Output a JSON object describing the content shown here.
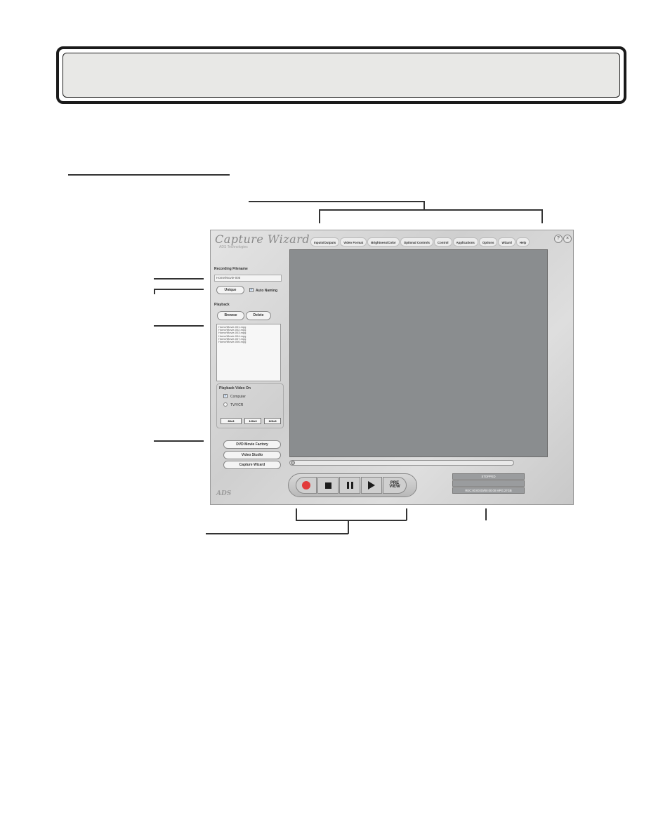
{
  "app": {
    "title": "Capture Wizard",
    "subtitle": "ADS Technologies",
    "help_btn": "?",
    "close_btn": "×",
    "tabs": [
      "Inputs/Outputs",
      "Video Format",
      "Brightness/Color",
      "Optional Controls",
      "Control",
      "Applications",
      "Options",
      "Wizard",
      "Help"
    ],
    "recording_label": "Recording Filename",
    "filename_value": "Home/Movie-005",
    "unique_btn": "Unique",
    "auto_naming_label": "Auto Naming",
    "playback_label": "Playback",
    "browse_btn": "Browse",
    "delete_btn": "Delete",
    "playback_files": [
      "Home/Movie-001.mpg",
      "Home/Movie-002.mpg",
      "Home/Movie-003.mpg",
      "Home/Movie-004.mpg",
      "Home/Movie-007.mpg",
      "Home/Movie-006.mpg"
    ],
    "playback_on_label": "Playback Video On",
    "option_computer": "Computer",
    "option_tvvcr": "TV/VCR",
    "rate_1": "80x3",
    "rate_2": "120x3",
    "rate_3": "120x3",
    "app_btn_1": "DVD Movie Factory",
    "app_btn_2": "Video Studio",
    "app_btn_3": "Capture Wizard",
    "preview_label_top": "PRE",
    "preview_label_bottom": "VIEW",
    "status_top": "STOPPED",
    "status_bottom": "REC:00:00:00/00:00:00 MPG:27GB",
    "logo": "ADS"
  },
  "colors": {
    "record": "#e23a3a",
    "video_area": "#8a8d8f",
    "status_bg": "#9a9c9e"
  }
}
